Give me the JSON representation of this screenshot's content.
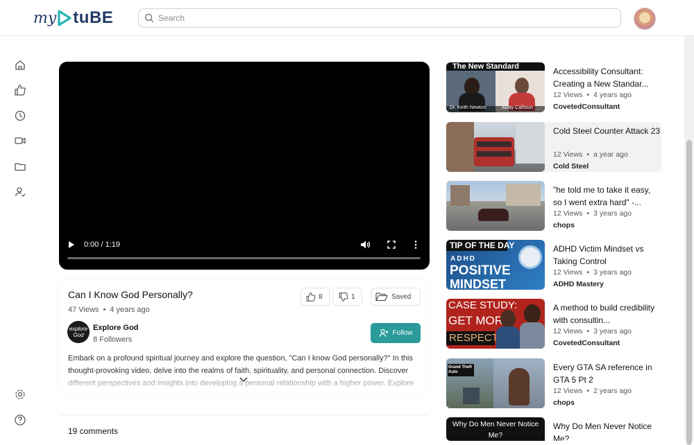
{
  "app": {
    "logo_prefix": "my",
    "logo_suffix": "tuBE"
  },
  "search": {
    "placeholder": "Search"
  },
  "sidebar": {
    "items": [
      {
        "icon": "home-icon"
      },
      {
        "icon": "thumbs-up-icon"
      },
      {
        "icon": "history-icon"
      },
      {
        "icon": "video-icon"
      },
      {
        "icon": "folder-icon"
      },
      {
        "icon": "user-check-icon"
      }
    ],
    "bottom": [
      {
        "icon": "settings-icon"
      },
      {
        "icon": "help-icon"
      }
    ]
  },
  "player": {
    "time": "0:00 / 1:19",
    "progress": 0
  },
  "video": {
    "title": "Can I Know God Personally?",
    "views": "47 Views",
    "age": "4 years ago",
    "likes": "8",
    "dislikes": "1",
    "saved_label": "Saved",
    "channel": "Explore God",
    "channel_avatar_text": "explore God",
    "followers": "8 Followers",
    "follow_label": "Follow",
    "description": "Embark on a profound spiritual journey and explore the question, \"Can I know God personally?\" In this thought-provoking video, delve into the realms of faith, spirituality, and personal connection. Discover different perspectives and insights into developing a personal relationship with a higher power. Explore"
  },
  "comments": {
    "count_label": "19 comments"
  },
  "recommendations": [
    {
      "title": "Accessibility Consultant: Creating a New Standar...",
      "views": "12 Views",
      "age": "4 years ago",
      "channel": "CovetedConsultant",
      "thumb_text": "The New Standard",
      "caption_left": "Dr. Keith Newton",
      "caption_right": "Aizay Calhoun"
    },
    {
      "title": "Cold Steel Counter Attack 23",
      "views": "12 Views",
      "age": "a year ago",
      "channel": "Cold Steel"
    },
    {
      "title": "\"he told me to take it easy, so I went extra hard\" -...",
      "views": "12 Views",
      "age": "3 years ago",
      "channel": "chops"
    },
    {
      "title": "ADHD Victim Mindset vs Taking Control",
      "views": "12 Views",
      "age": "3 years ago",
      "channel": "ADHD Mastery",
      "thumb_line1": "TIP OF THE DAY",
      "thumb_line2": "ADHD",
      "thumb_line3": "POSITIVE",
      "thumb_line4": "MINDSET"
    },
    {
      "title": "A method to build credibility with consultin...",
      "views": "12 Views",
      "age": "3 years ago",
      "channel": "CovetedConsultant",
      "thumb_line1": "CASE STUDY:",
      "thumb_line2": "GET MORE",
      "thumb_line3": "RESPECT"
    },
    {
      "title": "Every GTA SA reference in GTA 5 Pt 2",
      "views": "12 Views",
      "age": "2 years ago",
      "channel": "chops",
      "thumb_text": "Grand Theft Auto"
    },
    {
      "title": "Why Do Men Never Notice Me?",
      "thumb_text": "Why Do Men Never Notice Me?"
    }
  ]
}
